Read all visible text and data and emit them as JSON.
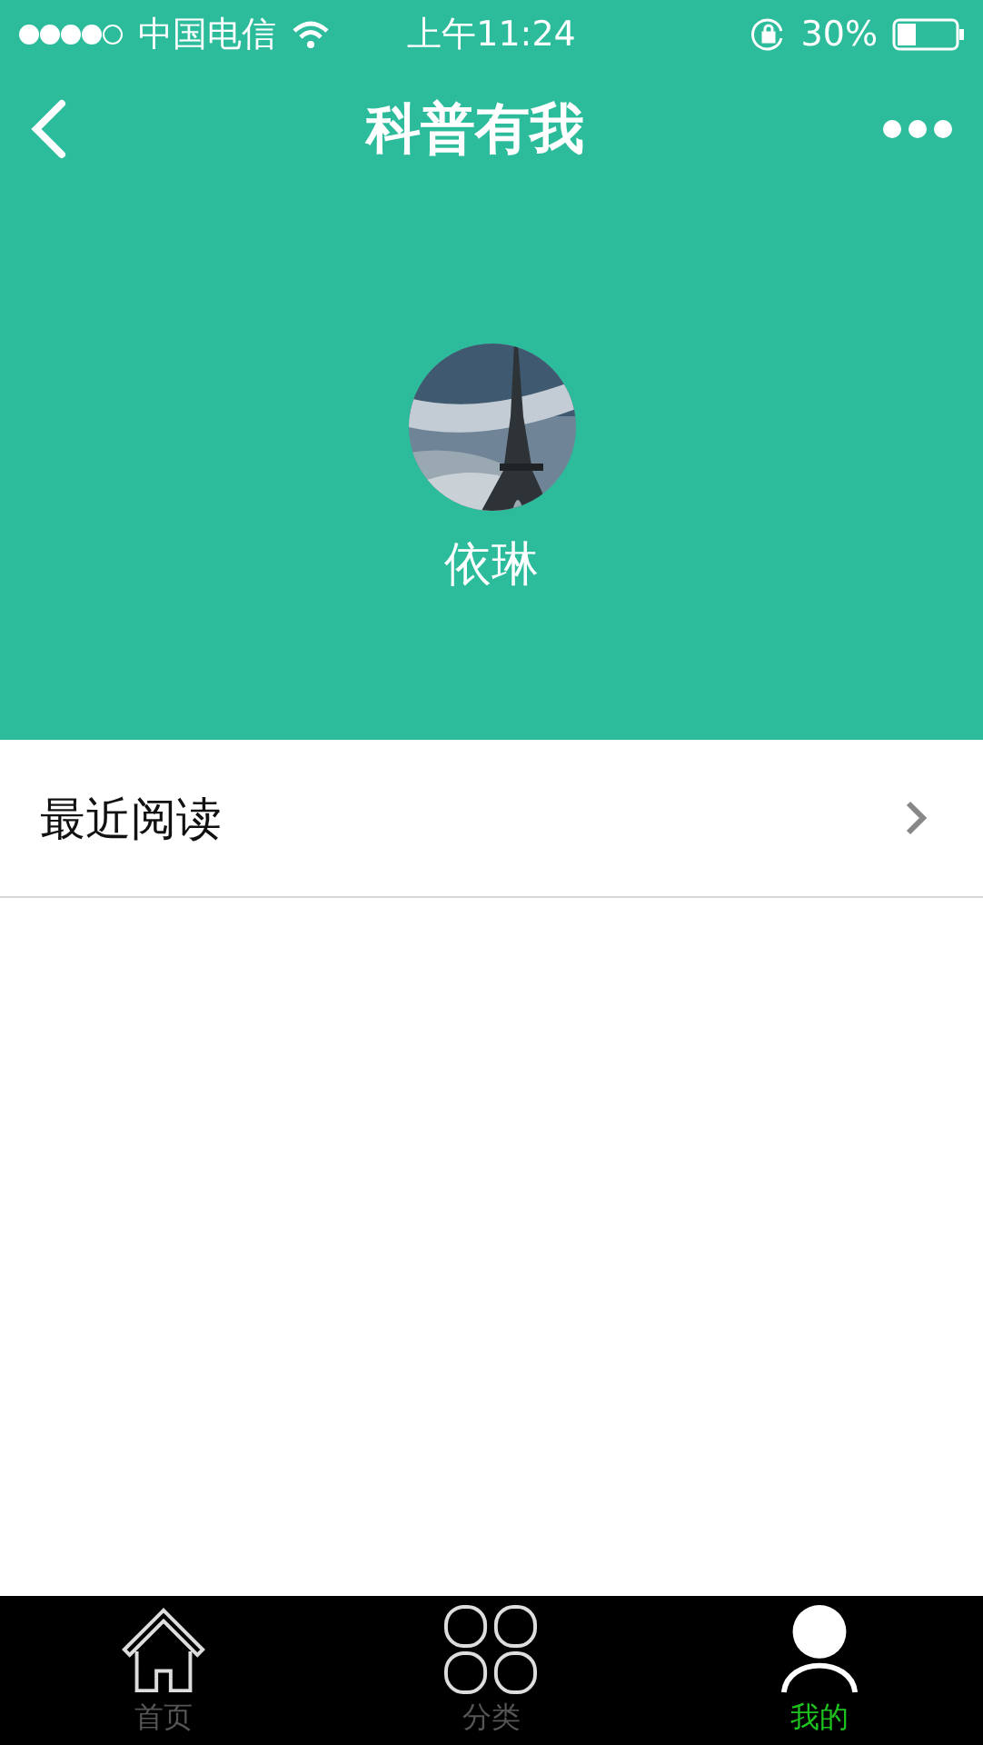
{
  "status_bar": {
    "carrier": "中国电信",
    "time": "上午11:24",
    "battery": "30%"
  },
  "nav_bar": {
    "title": "科普有我"
  },
  "profile": {
    "name": "依琳"
  },
  "menu": [
    {
      "label": "最近阅读"
    }
  ],
  "tab_bar": [
    {
      "label": "首页",
      "kind": "home",
      "selected": false
    },
    {
      "label": "分类",
      "kind": "category",
      "selected": false
    },
    {
      "label": "我的",
      "kind": "me",
      "selected": true
    }
  ]
}
